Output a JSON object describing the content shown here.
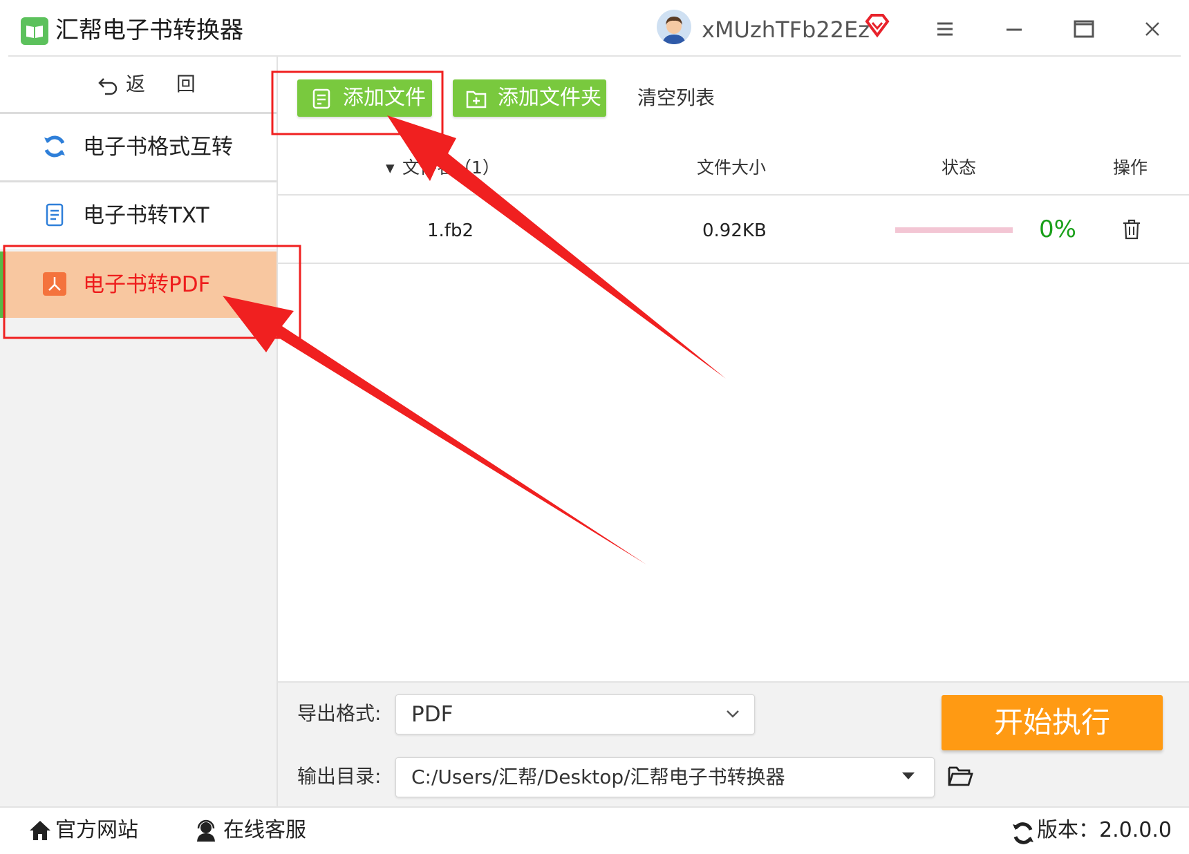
{
  "app": {
    "title": "汇帮电子书转换器",
    "username": "xMUzhTFb22Ez"
  },
  "colors": {
    "accent_green": "#79c93e",
    "active_item_bg": "#f8c7a0",
    "active_item_text": "#ee1c1c",
    "start_button": "#ff9a13",
    "status_green": "#1aa01a",
    "annotation_red": "#f02020"
  },
  "sidebar": {
    "back_label": "返 回",
    "items": [
      {
        "label": "电子书格式互转",
        "icon": "refresh-icon",
        "active": false
      },
      {
        "label": "电子书转TXT",
        "icon": "document-icon",
        "active": false
      },
      {
        "label": "电子书转PDF",
        "icon": "pdf-icon",
        "active": true
      }
    ]
  },
  "toolbar": {
    "add_file": "添加文件",
    "add_folder": "添加文件夹",
    "clear_list": "清空列表"
  },
  "table": {
    "headers": {
      "name": "文件名（1）",
      "size": "文件大小",
      "status": "状态",
      "action": "操作"
    },
    "rows": [
      {
        "name": "1.fb2",
        "size": "0.92KB",
        "progress": "0%"
      }
    ]
  },
  "settings": {
    "format_label": "导出格式:",
    "format_value": "PDF",
    "dir_label": "输出目录:",
    "dir_value": "C:/Users/汇帮/Desktop/汇帮电子书转换器",
    "start_button": "开始执行"
  },
  "footer": {
    "website": "官方网站",
    "support": "在线客服",
    "version": "版本：2.0.0.0"
  }
}
